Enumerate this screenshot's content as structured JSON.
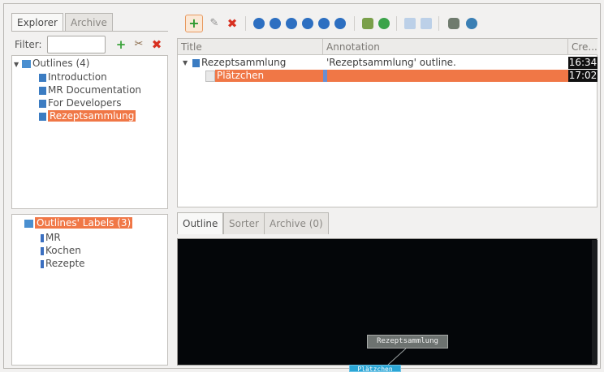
{
  "left_tabs": [
    "Explorer",
    "Archive"
  ],
  "filter": {
    "label": "Filter:",
    "value": ""
  },
  "outlines": {
    "header": "Outlines (4)",
    "items": [
      "Introduction",
      "MR Documentation",
      "For Developers",
      "Rezeptsammlung"
    ]
  },
  "labels": {
    "header": "Outlines' Labels (3)",
    "items": [
      "MR",
      "Kochen",
      "Rezepte"
    ]
  },
  "table": {
    "columns": [
      "Title",
      "Annotation",
      "Cre..."
    ],
    "rows": [
      {
        "title": "Rezeptsammlung",
        "annotation": "'Rezeptsammlung' outline.",
        "created": "16:34"
      },
      {
        "title": "Plätzchen",
        "annotation": "",
        "created": "17:02"
      }
    ]
  },
  "bottom_tabs": [
    "Outline",
    "Sorter",
    "Archive (0)"
  ],
  "mindmap": {
    "root": "Rezeptsammlung",
    "child": "Plätzchen"
  },
  "colors": {
    "selection": "#f07746",
    "map_bg": "#040609",
    "node_child": "#2ba6d6"
  }
}
